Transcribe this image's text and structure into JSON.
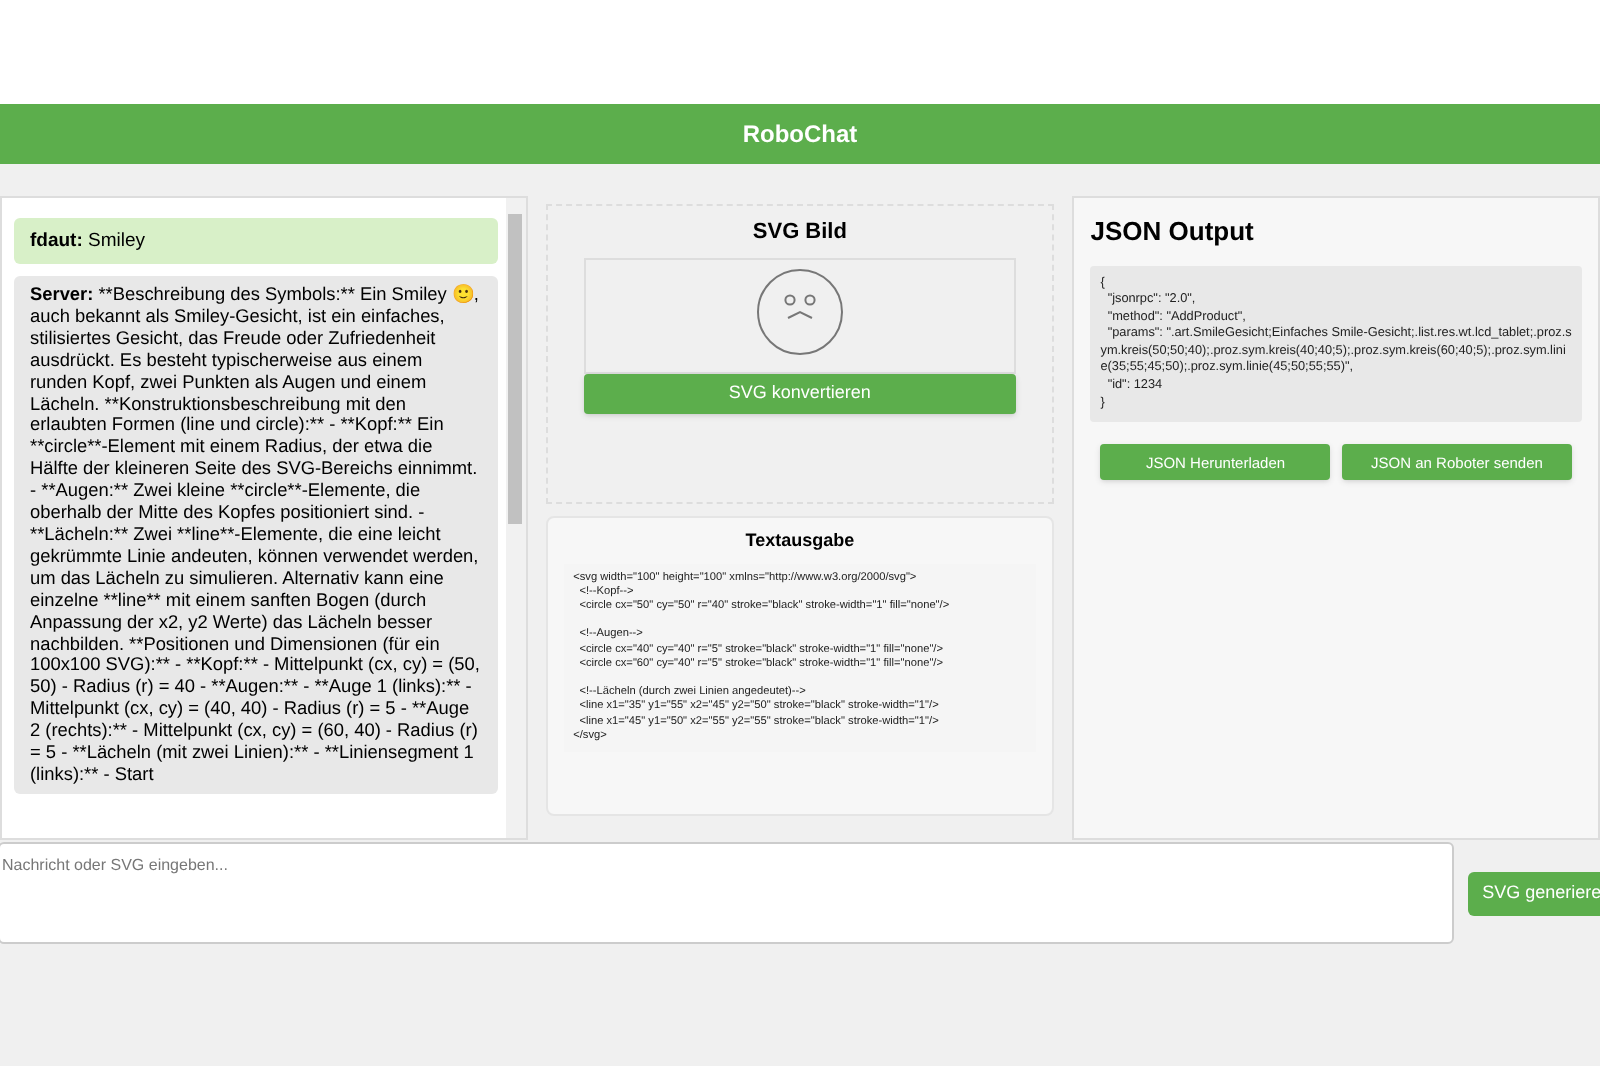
{
  "header": {
    "title": "RoboChat"
  },
  "chat": {
    "messages": [
      {
        "kind": "user",
        "sender": "fdaut:",
        "text": "Smiley"
      },
      {
        "kind": "server",
        "sender": "Server:",
        "text": "**Beschreibung des Symbols:** Ein Smiley 🙂, auch bekannt als Smiley-Gesicht, ist ein einfaches, stilisiertes Gesicht, das Freude oder Zufriedenheit ausdrückt. Es besteht typischerweise aus einem runden Kopf, zwei Punkten als Augen und einem Lächeln. **Konstruktionsbeschreibung mit den erlaubten Formen (line und circle):** - **Kopf:** Ein **circle**-Element mit einem Radius, der etwa die Hälfte der kleineren Seite des SVG-Bereichs einnimmt. - **Augen:** Zwei kleine **circle**-Elemente, die oberhalb der Mitte des Kopfes positioniert sind. - **Lächeln:** Zwei **line**-Elemente, die eine leicht gekrümmte Linie andeuten, können verwendet werden, um das Lächeln zu simulieren. Alternativ kann eine einzelne **line** mit einem sanften Bogen (durch Anpassung der x2, y2 Werte) das Lächeln besser nachbilden. **Positionen und Dimensionen (für ein 100x100 SVG):** - **Kopf:** - Mittelpunkt (cx, cy) = (50, 50) - Radius (r) = 40 - **Augen:** - **Auge 1 (links):** - Mittelpunkt (cx, cy) = (40, 40) - Radius (r) = 5 - **Auge 2 (rechts):** - Mittelpunkt (cx, cy) = (60, 40) - Radius (r) = 5 - **Lächeln (mit zwei Linien):** - **Liniensegment 1 (links):** - Start"
      }
    ]
  },
  "svg_panel": {
    "title": "SVG Bild",
    "button": "SVG konvertieren"
  },
  "text_panel": {
    "title": "Textausgabe",
    "blocks": [
      [
        "<svg width=\"100\" height=\"100\" xmlns=\"http://www.w3.org/2000/svg\">",
        "  <!--Kopf-->",
        "  <circle cx=\"50\" cy=\"50\" r=\"40\" stroke=\"black\" stroke-width=\"1\" fill=\"none\"/>"
      ],
      [
        "  <!--Augen-->",
        "  <circle cx=\"40\" cy=\"40\" r=\"5\" stroke=\"black\" stroke-width=\"1\" fill=\"none\"/>",
        "  <circle cx=\"60\" cy=\"40\" r=\"5\" stroke=\"black\" stroke-width=\"1\" fill=\"none\"/>"
      ],
      [
        "  <!--Lächeln (durch zwei Linien angedeutet)-->",
        "  <line x1=\"35\" y1=\"55\" x2=\"45\" y2=\"50\" stroke=\"black\" stroke-width=\"1\"/>",
        "  <line x1=\"45\" y1=\"50\" x2=\"55\" y2=\"55\" stroke=\"black\" stroke-width=\"1\"/>",
        "</svg>"
      ]
    ]
  },
  "json_panel": {
    "title": "JSON Output",
    "code": "{\n  \"jsonrpc\": \"2.0\",\n  \"method\": \"AddProduct\",\n  \"params\": \".art.SmileGesicht;Einfaches Smile-Gesicht;.list.res.wt.lcd_tablet;.proz.sym.kreis(50;50;40);.proz.sym.kreis(40;40;5);.proz.sym.kreis(60;40;5);.proz.sym.linie(35;55;45;50);.proz.sym.linie(45;50;55;55)\",\n  \"id\": 1234\n}",
    "buttons": [
      "JSON Herunterladen",
      "JSON an Roboter senden"
    ]
  },
  "composer": {
    "placeholder": "Nachricht oder SVG eingeben...",
    "button": "SVG generiere"
  }
}
